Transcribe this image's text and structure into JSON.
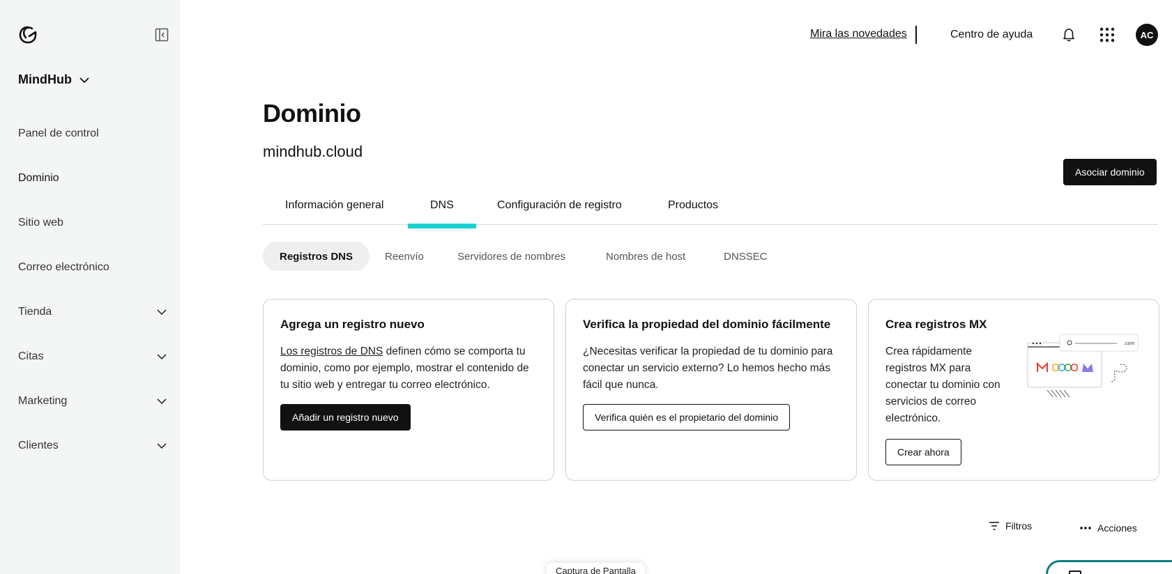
{
  "sidebar": {
    "workspace": "MindHub",
    "items": [
      {
        "label": "Panel de control",
        "expandable": false
      },
      {
        "label": "Dominio",
        "expandable": false,
        "active": true
      },
      {
        "label": "Sitio web",
        "expandable": false
      },
      {
        "label": "Correo electrónico",
        "expandable": false
      },
      {
        "label": "Tienda",
        "expandable": true
      },
      {
        "label": "Citas",
        "expandable": true
      },
      {
        "label": "Marketing",
        "expandable": true
      },
      {
        "label": "Clientes",
        "expandable": true
      }
    ]
  },
  "header": {
    "news_link": "Mira las novedades",
    "help": "Centro de ayuda",
    "avatar_initials": "AC"
  },
  "main": {
    "title": "Dominio",
    "domain": "mindhub.cloud",
    "connect_button": "Asociar dominio",
    "tabs": [
      {
        "label": "Información general"
      },
      {
        "label": "DNS",
        "active": true
      },
      {
        "label": "Configuración de registro"
      },
      {
        "label": "Productos"
      }
    ],
    "subtabs": [
      {
        "label": "Registros DNS",
        "active": true
      },
      {
        "label": "Reenvío"
      },
      {
        "label": "Servidores de nombres"
      },
      {
        "label": "Nombres de host"
      },
      {
        "label": "DNSSEC"
      }
    ],
    "cards": [
      {
        "title": "Agrega un registro nuevo",
        "link_text": "Los registros de DNS",
        "body_rest": " definen cómo se comporta tu dominio, como por ejemplo, mostrar el contenido de tu sitio web y entregar tu correo electrónico.",
        "button": "Añadir un registro nuevo"
      },
      {
        "title": "Verifica la propiedad del dominio fácilmente",
        "body": "¿Necesitas verificar la propiedad de tu dominio para conectar un servicio externo? Lo hemos hecho más fácil que nunca.",
        "button": "Verifica quién es el propietario del dominio"
      },
      {
        "title": "Crea registros MX",
        "body": "Crea rápidamente registros MX para conectar tu dominio con servicios de correo electrónico.",
        "button": "Crear ahora",
        "illustration_text": ".com"
      }
    ],
    "toolbar": {
      "filters": "Filtros",
      "actions": "Acciones"
    }
  },
  "overlay": {
    "capture_label": "Captura de Pantalla"
  },
  "colors": {
    "accent": "#1bd0d0",
    "sidebar_bg": "#f4f6f6",
    "dark": "#111111"
  }
}
